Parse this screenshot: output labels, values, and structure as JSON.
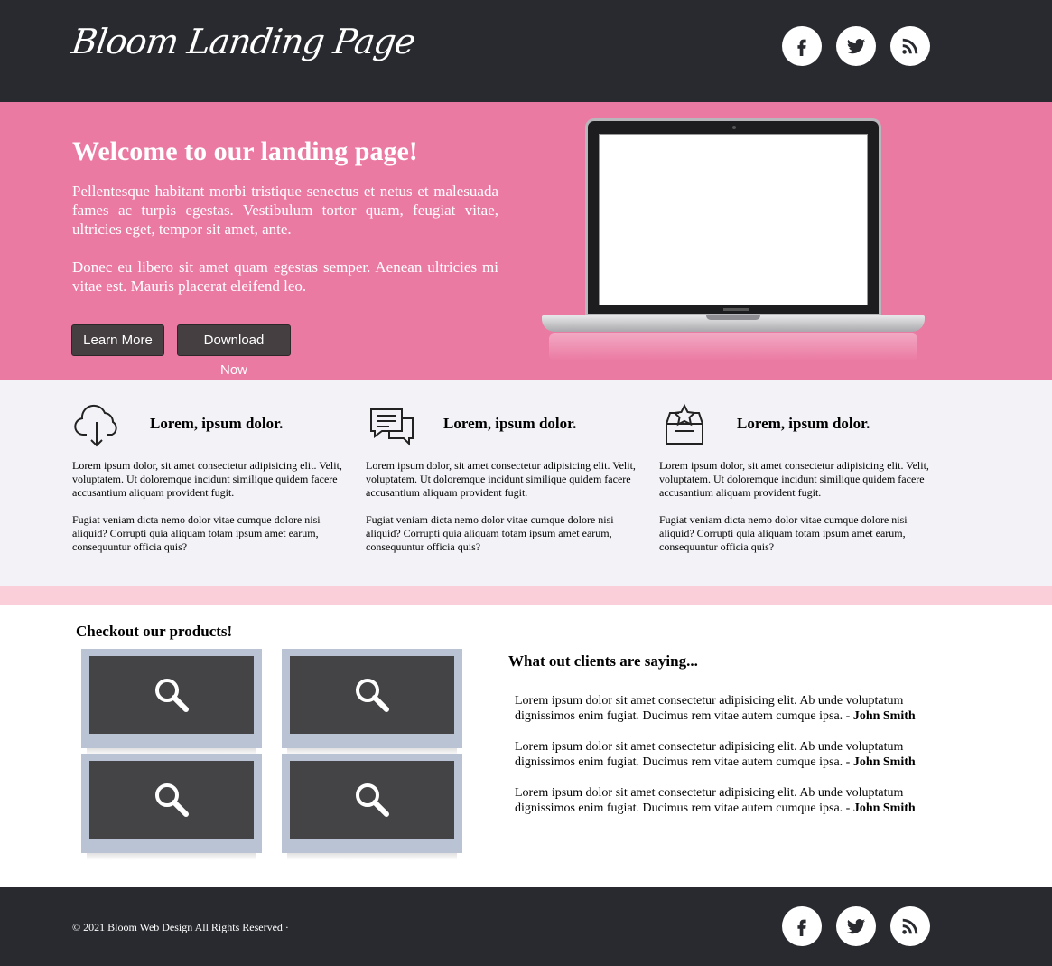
{
  "header": {
    "logo": "Bloom Landing Page",
    "social": [
      "facebook-icon",
      "twitter-icon",
      "rss-icon"
    ]
  },
  "hero": {
    "title": "Welcome to our landing page!",
    "paragraph1": "Pellentesque habitant morbi tristique senectus et netus et malesuada fames ac turpis egestas. Vestibulum tortor quam, feugiat vitae, ultricies eget, tempor sit amet, ante.",
    "paragraph2": "Donec eu libero sit amet quam egestas semper. Aenean ultricies mi vitae est. Mauris placerat eleifend leo.",
    "learn_more": "Learn More",
    "download_now": "Download Now"
  },
  "features": [
    {
      "icon": "cloud-download-icon",
      "title": "Lorem, ipsum dolor.",
      "text1": "Lorem ipsum dolor, sit amet consectetur adipisicing elit. Velit, voluptatem. Ut doloremque incidunt similique quidem facere accusantium aliquam provident fugit.",
      "text2": "Fugiat veniam dicta nemo dolor vitae cumque dolore nisi aliquid? Corrupti quia aliquam totam ipsum amet earum, consequuntur officia quis?"
    },
    {
      "icon": "chat-bubbles-icon",
      "title": "Lorem, ipsum dolor.",
      "text1": "Lorem ipsum dolor, sit amet consectetur adipisicing elit. Velit, voluptatem. Ut doloremque incidunt similique quidem facere accusantium aliquam provident fugit.",
      "text2": "Fugiat veniam dicta nemo dolor vitae cumque dolore nisi aliquid? Corrupti quia aliquam totam ipsum amet earum, consequuntur officia quis?"
    },
    {
      "icon": "star-folder-icon",
      "title": "Lorem, ipsum dolor.",
      "text1": "Lorem ipsum dolor, sit amet consectetur adipisicing elit. Velit, voluptatem. Ut doloremque incidunt similique quidem facere accusantium aliquam provident fugit.",
      "text2": "Fugiat veniam dicta nemo dolor vitae cumque dolore nisi aliquid? Corrupti quia aliquam totam ipsum amet earum, consequuntur officia quis?"
    }
  ],
  "products": {
    "title": "Checkout our products!"
  },
  "testimonials": {
    "title": "What out clients are saying...",
    "items": [
      {
        "text": "Lorem ipsum dolor sit amet consectetur adipisicing elit. Ab unde voluptatum dignissimos enim fugiat. Ducimus rem vitae autem cumque ipsa. -",
        "author": "John Smith"
      },
      {
        "text": "Lorem ipsum dolor sit amet consectetur adipisicing elit. Ab unde voluptatum dignissimos enim fugiat. Ducimus rem vitae autem cumque ipsa. -",
        "author": "John Smith"
      },
      {
        "text": "Lorem ipsum dolor sit amet consectetur adipisicing elit. Ab unde voluptatum dignissimos enim fugiat. Ducimus rem vitae autem cumque ipsa. -",
        "author": "John Smith"
      }
    ]
  },
  "footer": {
    "copyright": "© 2021 Bloom Web Design All Rights Reserved ·"
  },
  "colors": {
    "header_bg": "#282a2f",
    "hero_bg": "#eb7aa2",
    "features_bg": "#f3f2f6",
    "pink_band": "#fbcfd9",
    "button_bg": "#453f42"
  }
}
